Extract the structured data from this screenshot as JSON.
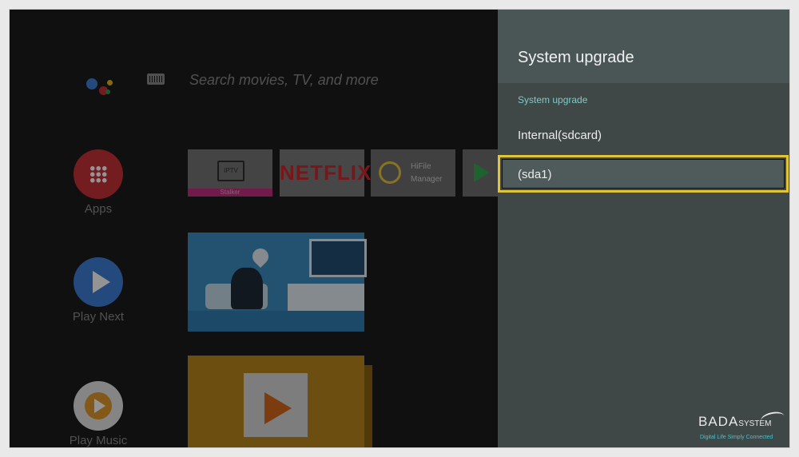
{
  "home": {
    "search_placeholder": "Search movies, TV, and more",
    "side_items": [
      {
        "label": "Apps",
        "icon": "apps-grid-icon"
      },
      {
        "label": "Play Next",
        "icon": "play-icon"
      },
      {
        "label": "Play Music",
        "icon": "play-music-icon"
      }
    ],
    "apps_row": [
      {
        "name": "IPTV",
        "sub": "Stalker"
      },
      {
        "name": "NETFLIX"
      },
      {
        "name_line1": "HiFile",
        "name_line2": "Manager"
      },
      {
        "name": "Google Play Store"
      }
    ]
  },
  "panel": {
    "title": "System upgrade",
    "section_label": "System upgrade",
    "items": [
      {
        "label": "Internal(sdcard)",
        "selected": false
      },
      {
        "label": "(sda1)",
        "selected": true
      }
    ]
  },
  "watermark": {
    "brand": "BADA",
    "brand_suffix": "SYSTEM",
    "tagline": "Digital Life Simply Connected"
  },
  "colors": {
    "panel_bg": "#3f4747",
    "panel_header_bg": "#4a5555",
    "section_accent": "#7fcbc4",
    "focus_border": "#e2c534"
  }
}
